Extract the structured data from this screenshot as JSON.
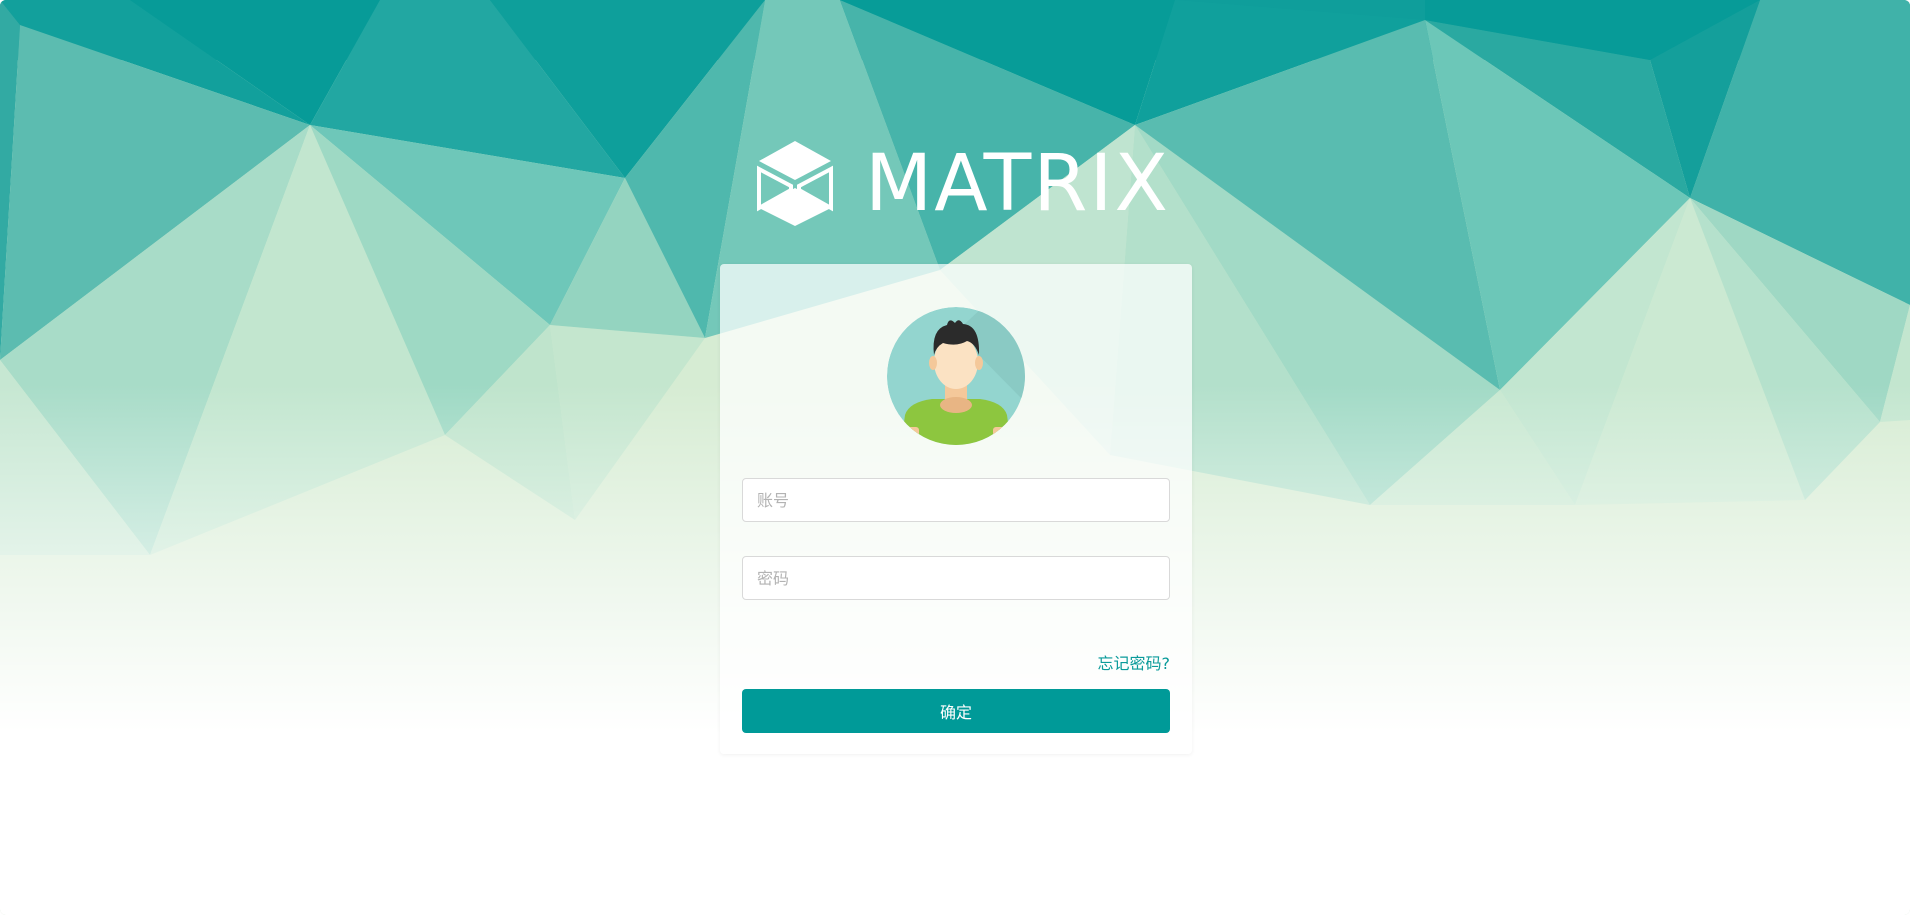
{
  "brand": {
    "name": "MATRIX",
    "logo_icon": "cube-logo-icon"
  },
  "login": {
    "avatar_icon": "user-avatar-icon",
    "account_placeholder": "账号",
    "account_value": "",
    "password_placeholder": "密码",
    "password_value": "",
    "forgot_label": "忘记密码?",
    "submit_label": "确定"
  },
  "colors": {
    "accent": "#009a98",
    "link": "#0a9b9a",
    "teal_dark": "#0a9b9a",
    "mint_light": "#d4ecd5"
  }
}
